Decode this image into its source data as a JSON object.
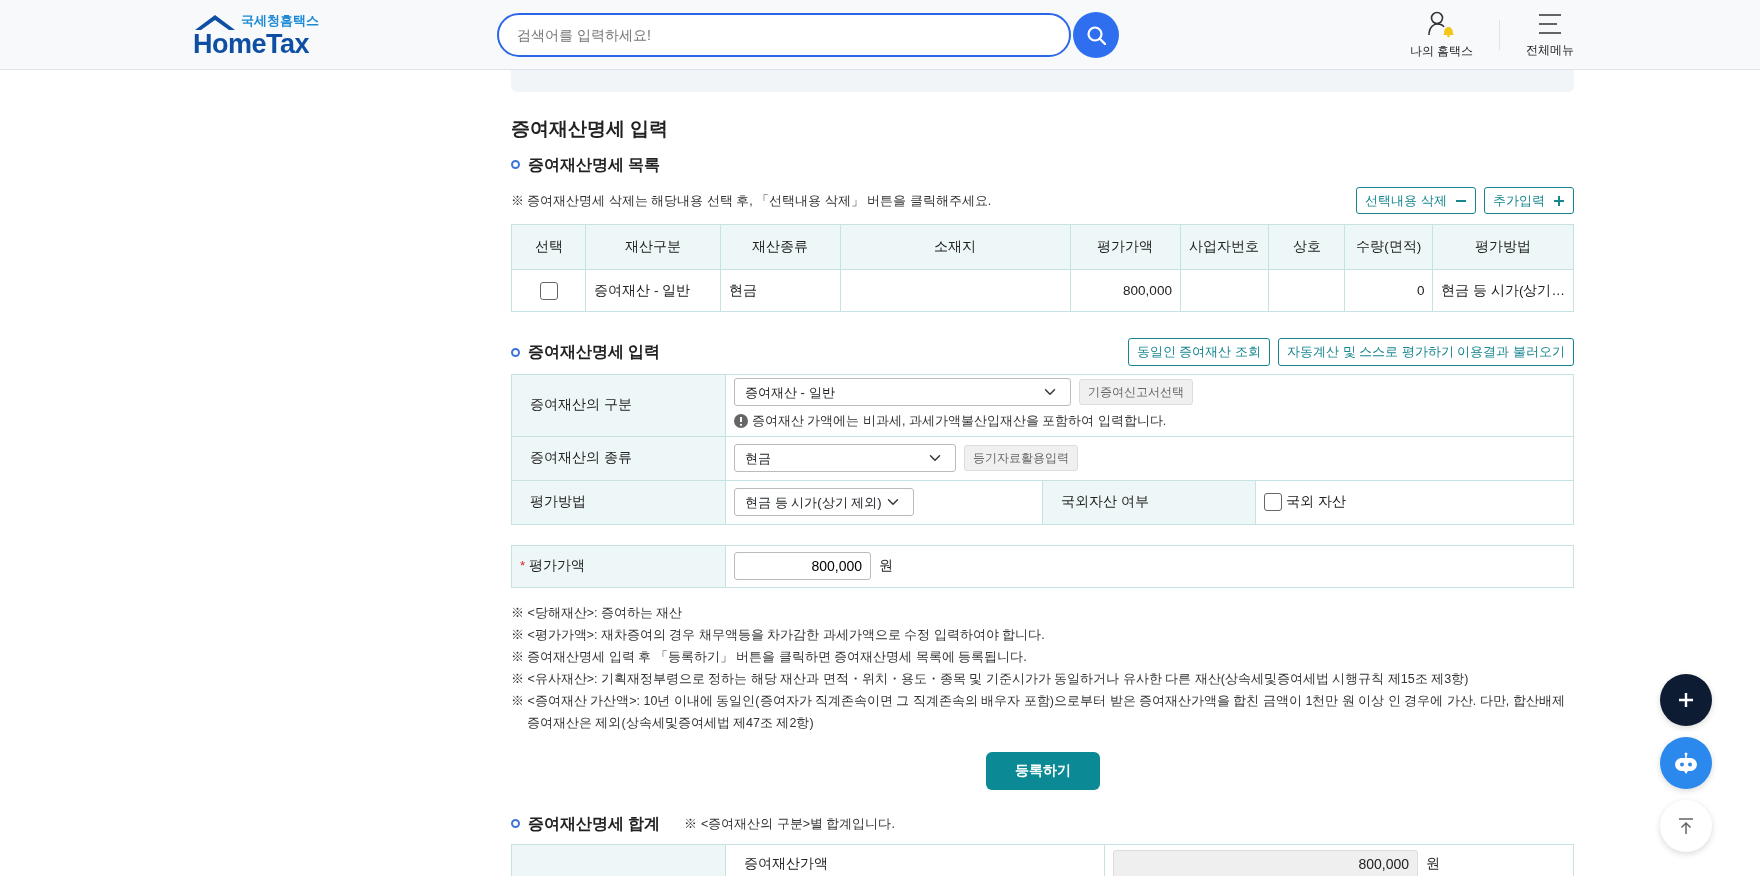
{
  "header": {
    "logo": {
      "subtitle": "국세청홈택스",
      "title": "HomeTax"
    },
    "search": {
      "placeholder": "검색어를 입력하세요!"
    },
    "nav": [
      {
        "kind": "user",
        "label": "나의 홈택스"
      },
      {
        "kind": "menu",
        "label": "전체메뉴"
      }
    ]
  },
  "page_title": "증여재산명세 입력",
  "list_section": {
    "title": "증여재산명세 목록",
    "note": "※ 증여재산명세 삭제는 해당내용 선택 후, 「선택내용 삭제」 버튼을 클릭해주세요.",
    "buttons": [
      {
        "kind": "minus",
        "label": "선택내용 삭제"
      },
      {
        "kind": "plus",
        "label": "추가입력"
      }
    ],
    "table": {
      "columns": [
        "선택",
        "재산구분",
        "재산종류",
        "소재지",
        "평가가액",
        "사업자번호",
        "상호",
        "수량(면적)",
        "평가방법"
      ],
      "rows": [
        {
          "selected": false,
          "cells": [
            "",
            "증여재산 - 일반",
            "현금",
            "",
            "800,000",
            "",
            "",
            "0",
            "현금 등 시가(상기…"
          ]
        }
      ]
    }
  },
  "input_section": {
    "title": "증여재산명세 입력",
    "buttons": [
      "동일인 증여재산 조회",
      "자동계산 및 스스로 평가하기 이용결과 불러오기"
    ],
    "category": {
      "label": "증여재산의 구분",
      "value": "증여재산 - 일반",
      "button": "기증여신고서선택",
      "info": "증여재산 가액에는 비과세, 과세가액불산입재산을 포함하여 입력합니다."
    },
    "type": {
      "label": "증여재산의 종류",
      "value": "현금",
      "button": "등기자료활용입력"
    },
    "method": {
      "label": "평가방법",
      "value": "현금 등 시가(상기 제외)",
      "foreign_label": "국외자산 여부",
      "foreign_checkbox": {
        "label": "국외 자산",
        "checked": false
      }
    },
    "amount": {
      "required_mark": "*",
      "label": "평가가액",
      "value": "800,000",
      "unit": "원"
    }
  },
  "notes": [
    "※ <당해재산>: 증여하는 재산",
    "※ <평가가액>: 재차증여의 경우 채무액등을 차가감한 과세가액으로 수정 입력하여야 합니다.",
    "※ 증여재산명세 입력 후 「등록하기」 버튼을 클릭하면 증여재산명세 목록에 등록됩니다.",
    "※ <유사재산>: 기획재정부령으로 정하는 해당 재산과 면적・위치・용도・종목 및 기준시가가 동일하거나 유사한 다른 재산(상속세및증여세법 시행규칙 제15조 제3항)",
    "※ <증여재산 가산액>: 10년 이내에 동일인(증여자가 직계존속이면 그 직계존속의 배우자 포함)으로부터 받은 증여재산가액을 합친 금액이 1천만 원 이상 인 경우에 가산. 다만, 합산배제증여재산은 제외(상속세및증여세법 제47조 제2항)"
  ],
  "register_button": "등록하기",
  "summary_section": {
    "title": "증여재산명세 합계",
    "note": "※ <증여재산의 구분>별 합계입니다.",
    "rows": [
      {
        "label": "증여재산가액",
        "value": "800,000",
        "unit": "원"
      }
    ]
  },
  "floating_buttons": [
    {
      "kind": "add"
    },
    {
      "kind": "chatbot"
    },
    {
      "kind": "top"
    }
  ]
}
